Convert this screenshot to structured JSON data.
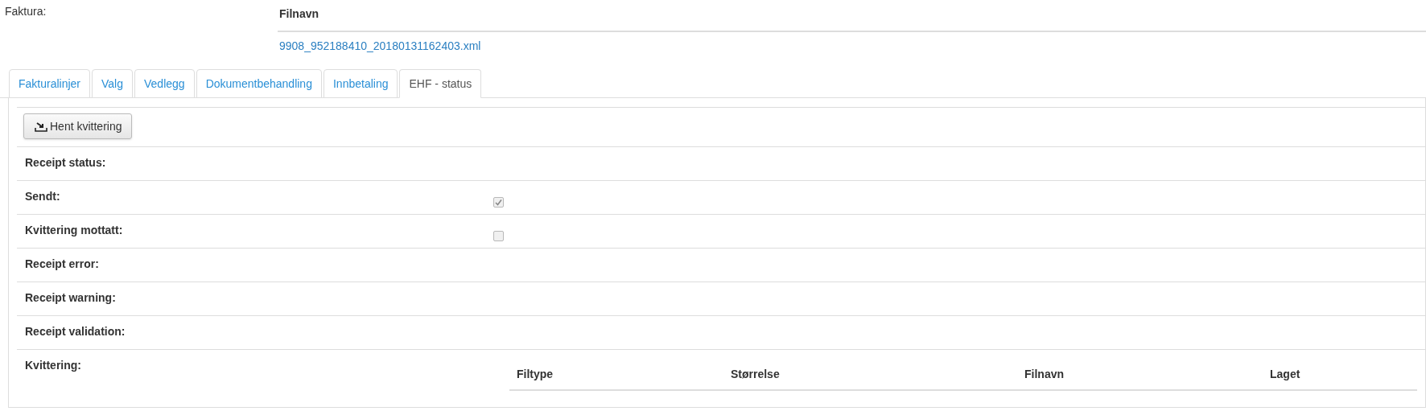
{
  "invoice": {
    "label": "Faktura:",
    "files": {
      "columns": [
        "Filnavn"
      ],
      "rows": [
        [
          "9908_952188410_20180131162403.xml"
        ]
      ]
    }
  },
  "tabs": [
    {
      "label": "Fakturalinjer",
      "selected": false
    },
    {
      "label": "Valg",
      "selected": false
    },
    {
      "label": "Vedlegg",
      "selected": false
    },
    {
      "label": "Dokumentbehandling",
      "selected": false
    },
    {
      "label": "Innbetaling",
      "selected": false
    },
    {
      "label": "EHF - status",
      "selected": true
    }
  ],
  "fetch_button": {
    "label": "Hent kvittering"
  },
  "fields": [
    {
      "kind": "empty",
      "label": "Receipt status:"
    },
    {
      "kind": "checkbox",
      "label": "Sendt:",
      "checked": true
    },
    {
      "kind": "checkbox",
      "label": "Kvittering mottatt:",
      "checked": false
    },
    {
      "kind": "empty",
      "label": "Receipt error:"
    },
    {
      "kind": "empty",
      "label": "Receipt warning:"
    },
    {
      "kind": "empty",
      "label": "Receipt validation:"
    },
    {
      "kind": "table",
      "label": "Kvittering:",
      "columns": [
        "Filtype",
        "Størrelse",
        "Filnavn",
        "Laget"
      ]
    }
  ]
}
